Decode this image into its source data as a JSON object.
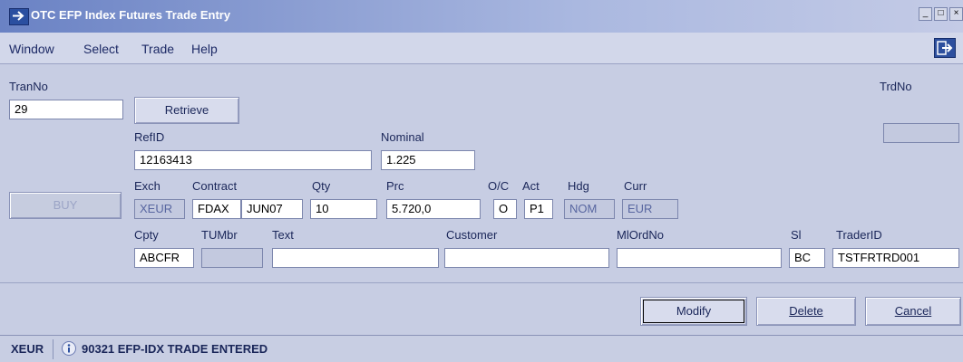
{
  "window": {
    "title": "OTC EFP Index Futures Trade Entry"
  },
  "menu": {
    "items": [
      "Window",
      "Select",
      "Trade",
      "Help"
    ]
  },
  "form": {
    "tranno": {
      "label": "TranNo",
      "value": "29"
    },
    "trdno": {
      "label": "TrdNo",
      "value": ""
    },
    "retrieve_label": "Retrieve",
    "refid": {
      "label": "RefID",
      "value": "12163413"
    },
    "nominal": {
      "label": "Nominal",
      "value": "1.225"
    },
    "buy_label": "BUY",
    "exch": {
      "label": "Exch",
      "value": "XEUR"
    },
    "contract": {
      "label": "Contract",
      "product": "FDAX",
      "month": "JUN07"
    },
    "qty": {
      "label": "Qty",
      "value": "10"
    },
    "prc": {
      "label": "Prc",
      "value": "5.720,0"
    },
    "oc": {
      "label": "O/C",
      "value": "O"
    },
    "act": {
      "label": "Act",
      "value": "P1"
    },
    "hdg": {
      "label": "Hdg",
      "value": "NOM"
    },
    "curr": {
      "label": "Curr",
      "value": "EUR"
    },
    "cpty": {
      "label": "Cpty",
      "value": "ABCFR"
    },
    "tumbr": {
      "label": "TUMbr",
      "value": ""
    },
    "text": {
      "label": "Text",
      "value": ""
    },
    "customer": {
      "label": "Customer",
      "value": ""
    },
    "mlordno": {
      "label": "MlOrdNo",
      "value": ""
    },
    "sl": {
      "label": "Sl",
      "value": "BC"
    },
    "traderid": {
      "label": "TraderID",
      "value": "TSTFRTRD001"
    }
  },
  "buttons": {
    "modify": "Modify",
    "delete": "Delete",
    "cancel": "Cancel"
  },
  "status": {
    "code": "XEUR",
    "message": "90321 EFP-IDX TRADE ENTERED"
  },
  "colors": {
    "title_gradient_start": "#6a82c4",
    "window_bg": "#c7cde3",
    "label_text": "#1a2659",
    "readonly_bg": "#c3c9df"
  },
  "icons": {
    "title": "arrow-right-icon",
    "exit": "exit-door-icon",
    "status": "info-icon"
  }
}
